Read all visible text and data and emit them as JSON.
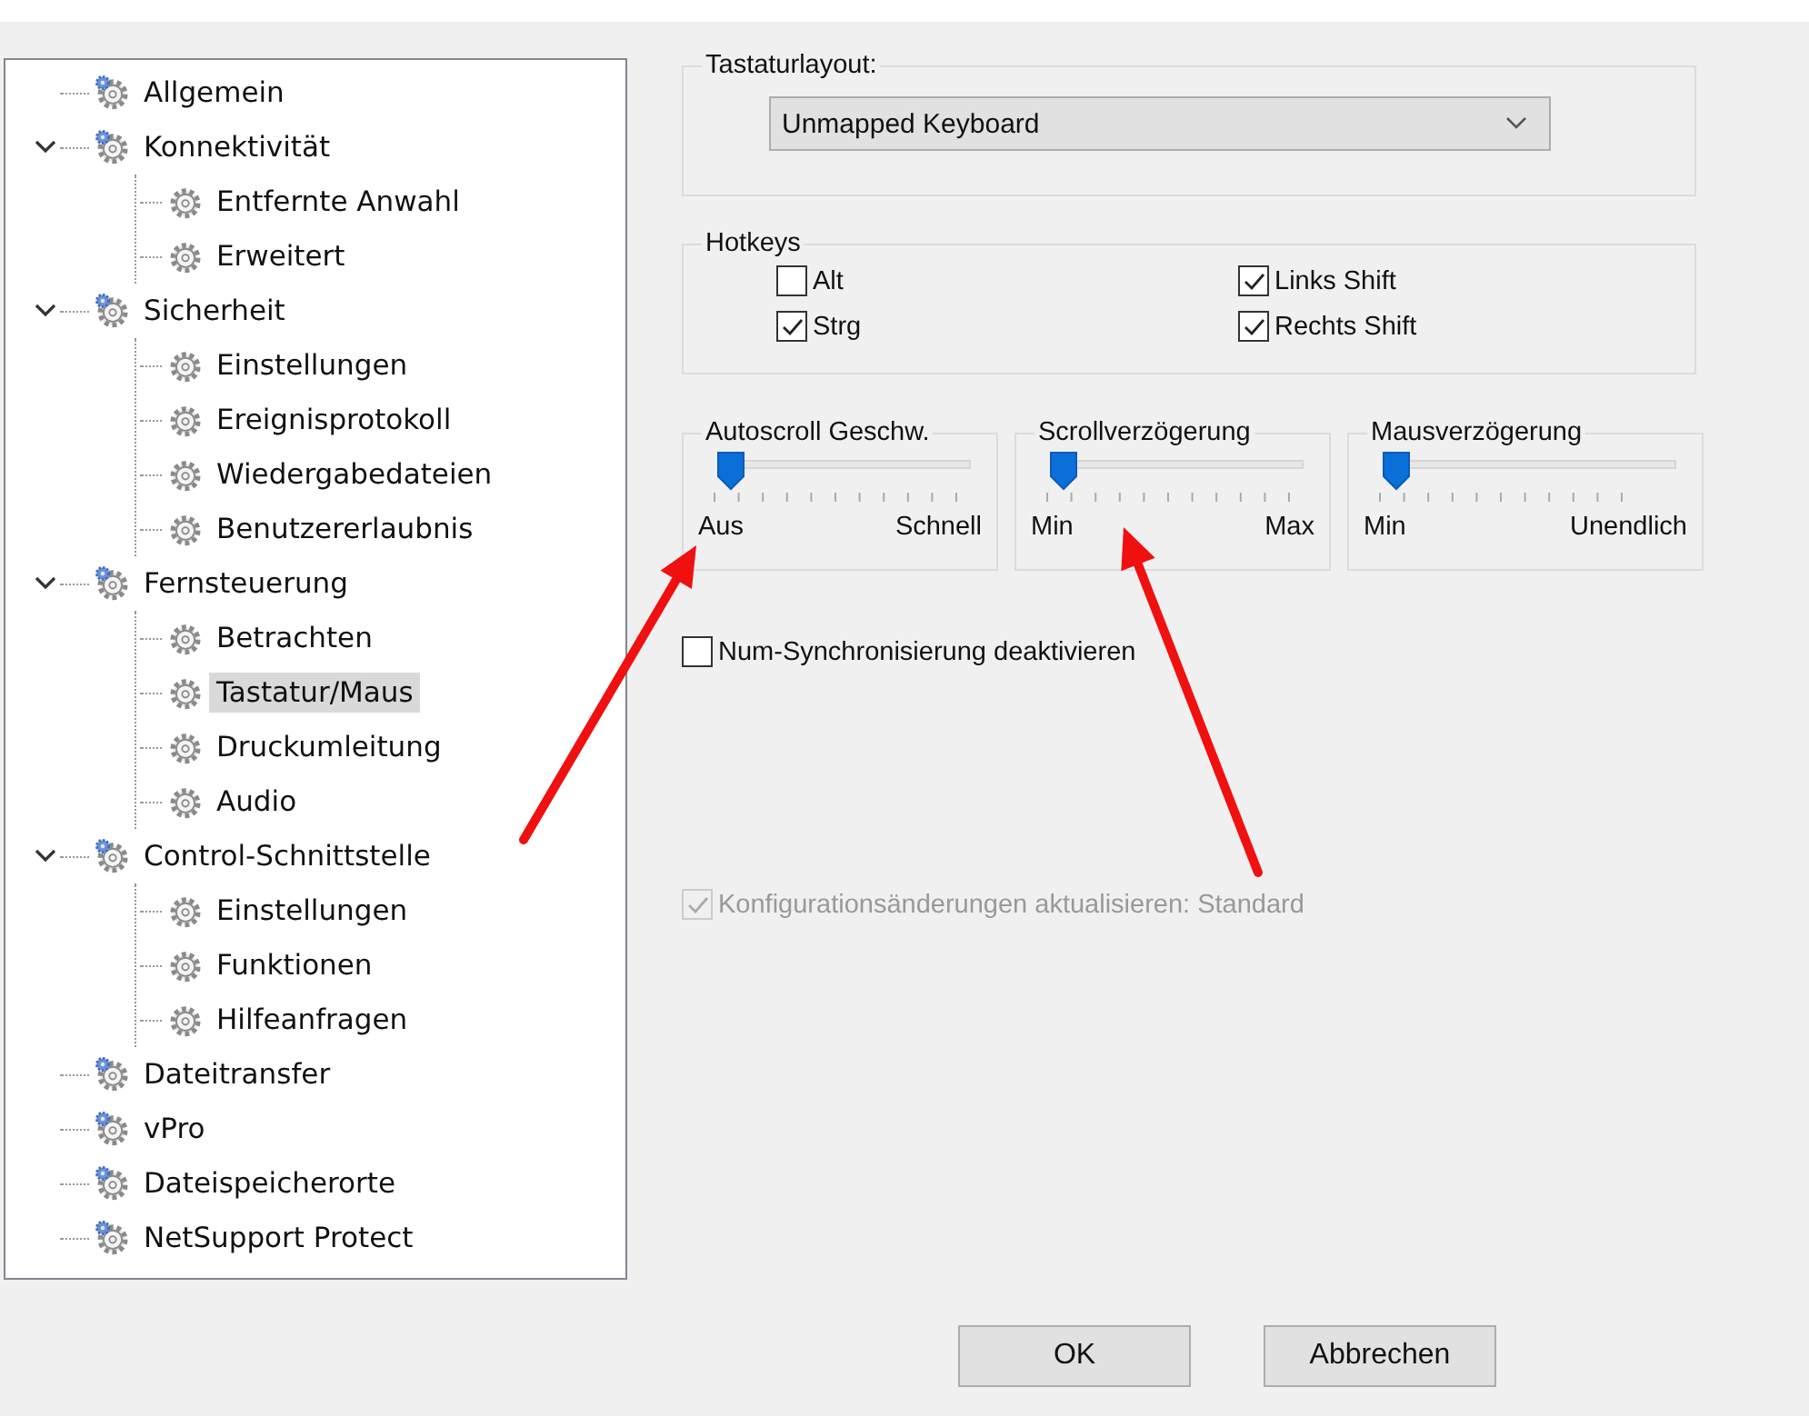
{
  "tree": [
    {
      "label": "Allgemein",
      "selected": false
    },
    {
      "label": "Konnektivität",
      "selected": false,
      "expanded": true,
      "children": [
        {
          "label": "Entfernte Anwahl",
          "selected": false
        },
        {
          "label": "Erweitert",
          "selected": false
        }
      ]
    },
    {
      "label": "Sicherheit",
      "selected": false,
      "expanded": true,
      "children": [
        {
          "label": "Einstellungen",
          "selected": false
        },
        {
          "label": "Ereignisprotokoll",
          "selected": false
        },
        {
          "label": "Wiedergabedateien",
          "selected": false
        },
        {
          "label": "Benutzererlaubnis",
          "selected": false
        }
      ]
    },
    {
      "label": "Fernsteuerung",
      "selected": false,
      "expanded": true,
      "children": [
        {
          "label": "Betrachten",
          "selected": false
        },
        {
          "label": "Tastatur/Maus",
          "selected": true
        },
        {
          "label": "Druckumleitung",
          "selected": false
        },
        {
          "label": "Audio",
          "selected": false
        }
      ]
    },
    {
      "label": "Control-Schnittstelle",
      "selected": false,
      "expanded": true,
      "children": [
        {
          "label": "Einstellungen",
          "selected": false
        },
        {
          "label": "Funktionen",
          "selected": false
        },
        {
          "label": "Hilfeanfragen",
          "selected": false
        }
      ]
    },
    {
      "label": "Dateitransfer",
      "selected": false
    },
    {
      "label": "vPro",
      "selected": false
    },
    {
      "label": "Dateispeicherorte",
      "selected": false
    },
    {
      "label": "NetSupport Protect",
      "selected": false
    }
  ],
  "keyboard_layout": {
    "label": "Tastaturlayout:",
    "value": "Unmapped Keyboard"
  },
  "hotkeys": {
    "label": "Hotkeys",
    "items": [
      {
        "label": "Alt",
        "checked": false
      },
      {
        "label": "Links Shift",
        "checked": true
      },
      {
        "label": "Strg",
        "checked": true
      },
      {
        "label": "Rechts Shift",
        "checked": true
      }
    ]
  },
  "sliders": [
    {
      "label": "Autoscroll Geschw.",
      "level": 0,
      "min_label": "Aus",
      "max_label": "Schnell"
    },
    {
      "label": "Scrollverzögerung",
      "level": 0,
      "min_label": "Min",
      "max_label": "Max"
    },
    {
      "label": "Mausverzögerung",
      "level": 0,
      "min_label": "Min",
      "max_label": "Unendlich"
    }
  ],
  "num_sync": {
    "label": "Num-Synchronisierung deaktivieren",
    "checked": false,
    "disabled": false
  },
  "config_update": {
    "label": "Konfigurationsänderungen aktualisieren: Standard",
    "checked": true,
    "disabled": true
  },
  "buttons": [
    "OK",
    "Abbrechen"
  ],
  "annotations": [
    {
      "kind": "arrow"
    },
    {
      "kind": "arrow"
    }
  ]
}
